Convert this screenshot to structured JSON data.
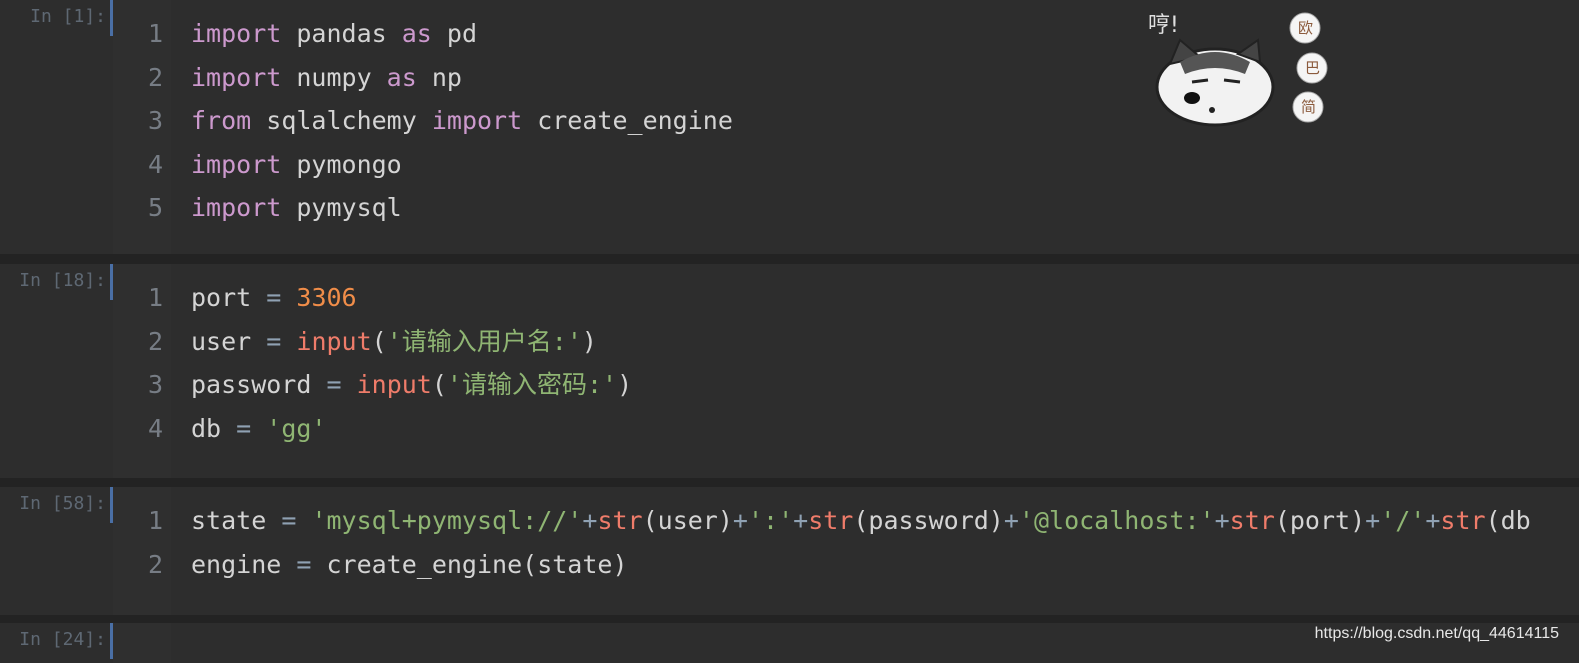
{
  "cells": [
    {
      "prompt": "In [1]:",
      "lines": [
        [
          [
            "kw",
            "import"
          ],
          [
            "tx",
            " pandas "
          ],
          [
            "kw",
            "as"
          ],
          [
            "tx",
            " pd"
          ]
        ],
        [
          [
            "kw",
            "import"
          ],
          [
            "tx",
            " numpy "
          ],
          [
            "kw",
            "as"
          ],
          [
            "tx",
            " np"
          ]
        ],
        [
          [
            "kw",
            "from"
          ],
          [
            "tx",
            " sqlalchemy "
          ],
          [
            "kw",
            "import"
          ],
          [
            "tx",
            " create_engine"
          ]
        ],
        [
          [
            "kw",
            "import"
          ],
          [
            "tx",
            " pymongo"
          ]
        ],
        [
          [
            "kw",
            "import"
          ],
          [
            "tx",
            " pymysql"
          ]
        ]
      ]
    },
    {
      "prompt": "In [18]:",
      "lines": [
        [
          [
            "tx",
            "port "
          ],
          [
            "op",
            "="
          ],
          [
            "tx",
            " "
          ],
          [
            "num",
            "3306"
          ]
        ],
        [
          [
            "tx",
            "user "
          ],
          [
            "op",
            "="
          ],
          [
            "tx",
            " "
          ],
          [
            "fn",
            "input"
          ],
          [
            "tx",
            "("
          ],
          [
            "str",
            "'请输入用户名:'"
          ],
          [
            "tx",
            ")"
          ]
        ],
        [
          [
            "tx",
            "password "
          ],
          [
            "op",
            "="
          ],
          [
            "tx",
            " "
          ],
          [
            "fn",
            "input"
          ],
          [
            "tx",
            "("
          ],
          [
            "str",
            "'请输入密码:'"
          ],
          [
            "tx",
            ")"
          ]
        ],
        [
          [
            "tx",
            "db "
          ],
          [
            "op",
            "="
          ],
          [
            "tx",
            " "
          ],
          [
            "str",
            "'gg'"
          ]
        ]
      ]
    },
    {
      "prompt": "In [58]:",
      "lines": [
        [
          [
            "tx",
            "state "
          ],
          [
            "op",
            "="
          ],
          [
            "tx",
            " "
          ],
          [
            "str",
            "'mysql+pymysql://'"
          ],
          [
            "op",
            "+"
          ],
          [
            "fn",
            "str"
          ],
          [
            "tx",
            "(user)"
          ],
          [
            "op",
            "+"
          ],
          [
            "str",
            "':'"
          ],
          [
            "op",
            "+"
          ],
          [
            "fn",
            "str"
          ],
          [
            "tx",
            "(password)"
          ],
          [
            "op",
            "+"
          ],
          [
            "str",
            "'@localhost:'"
          ],
          [
            "op",
            "+"
          ],
          [
            "fn",
            "str"
          ],
          [
            "tx",
            "(port)"
          ],
          [
            "op",
            "+"
          ],
          [
            "str",
            "'/'"
          ],
          [
            "op",
            "+"
          ],
          [
            "fn",
            "str"
          ],
          [
            "tx",
            "(db"
          ]
        ],
        [
          [
            "tx",
            "engine "
          ],
          [
            "op",
            "="
          ],
          [
            "tx",
            " create_engine(state)"
          ]
        ]
      ]
    },
    {
      "prompt": "In [24]:",
      "lines": []
    }
  ],
  "sticker": {
    "caption": "哼!",
    "side_text": [
      "欧",
      "巴",
      "简"
    ]
  },
  "watermark": "https://blog.csdn.net/qq_44614115",
  "colors": {
    "keyword": "#cc99cd",
    "number": "#f08d49",
    "builtin": "#ef7c6a",
    "string": "#8fb573",
    "operator": "#8fa1b3"
  }
}
